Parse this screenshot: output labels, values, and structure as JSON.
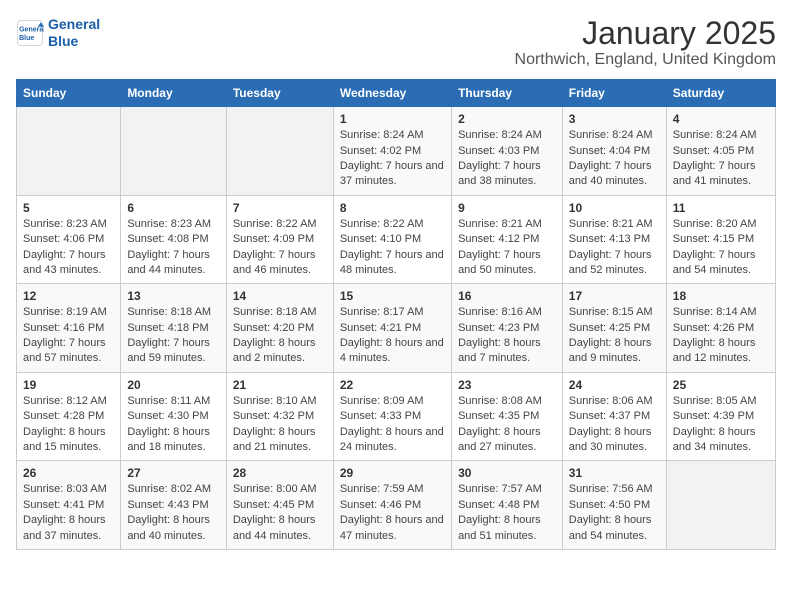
{
  "logo": {
    "line1": "General",
    "line2": "Blue"
  },
  "title": "January 2025",
  "subtitle": "Northwich, England, United Kingdom",
  "weekdays": [
    "Sunday",
    "Monday",
    "Tuesday",
    "Wednesday",
    "Thursday",
    "Friday",
    "Saturday"
  ],
  "weeks": [
    [
      {
        "day": "",
        "info": ""
      },
      {
        "day": "",
        "info": ""
      },
      {
        "day": "",
        "info": ""
      },
      {
        "day": "1",
        "info": "Sunrise: 8:24 AM\nSunset: 4:02 PM\nDaylight: 7 hours and 37 minutes."
      },
      {
        "day": "2",
        "info": "Sunrise: 8:24 AM\nSunset: 4:03 PM\nDaylight: 7 hours and 38 minutes."
      },
      {
        "day": "3",
        "info": "Sunrise: 8:24 AM\nSunset: 4:04 PM\nDaylight: 7 hours and 40 minutes."
      },
      {
        "day": "4",
        "info": "Sunrise: 8:24 AM\nSunset: 4:05 PM\nDaylight: 7 hours and 41 minutes."
      }
    ],
    [
      {
        "day": "5",
        "info": "Sunrise: 8:23 AM\nSunset: 4:06 PM\nDaylight: 7 hours and 43 minutes."
      },
      {
        "day": "6",
        "info": "Sunrise: 8:23 AM\nSunset: 4:08 PM\nDaylight: 7 hours and 44 minutes."
      },
      {
        "day": "7",
        "info": "Sunrise: 8:22 AM\nSunset: 4:09 PM\nDaylight: 7 hours and 46 minutes."
      },
      {
        "day": "8",
        "info": "Sunrise: 8:22 AM\nSunset: 4:10 PM\nDaylight: 7 hours and 48 minutes."
      },
      {
        "day": "9",
        "info": "Sunrise: 8:21 AM\nSunset: 4:12 PM\nDaylight: 7 hours and 50 minutes."
      },
      {
        "day": "10",
        "info": "Sunrise: 8:21 AM\nSunset: 4:13 PM\nDaylight: 7 hours and 52 minutes."
      },
      {
        "day": "11",
        "info": "Sunrise: 8:20 AM\nSunset: 4:15 PM\nDaylight: 7 hours and 54 minutes."
      }
    ],
    [
      {
        "day": "12",
        "info": "Sunrise: 8:19 AM\nSunset: 4:16 PM\nDaylight: 7 hours and 57 minutes."
      },
      {
        "day": "13",
        "info": "Sunrise: 8:18 AM\nSunset: 4:18 PM\nDaylight: 7 hours and 59 minutes."
      },
      {
        "day": "14",
        "info": "Sunrise: 8:18 AM\nSunset: 4:20 PM\nDaylight: 8 hours and 2 minutes."
      },
      {
        "day": "15",
        "info": "Sunrise: 8:17 AM\nSunset: 4:21 PM\nDaylight: 8 hours and 4 minutes."
      },
      {
        "day": "16",
        "info": "Sunrise: 8:16 AM\nSunset: 4:23 PM\nDaylight: 8 hours and 7 minutes."
      },
      {
        "day": "17",
        "info": "Sunrise: 8:15 AM\nSunset: 4:25 PM\nDaylight: 8 hours and 9 minutes."
      },
      {
        "day": "18",
        "info": "Sunrise: 8:14 AM\nSunset: 4:26 PM\nDaylight: 8 hours and 12 minutes."
      }
    ],
    [
      {
        "day": "19",
        "info": "Sunrise: 8:12 AM\nSunset: 4:28 PM\nDaylight: 8 hours and 15 minutes."
      },
      {
        "day": "20",
        "info": "Sunrise: 8:11 AM\nSunset: 4:30 PM\nDaylight: 8 hours and 18 minutes."
      },
      {
        "day": "21",
        "info": "Sunrise: 8:10 AM\nSunset: 4:32 PM\nDaylight: 8 hours and 21 minutes."
      },
      {
        "day": "22",
        "info": "Sunrise: 8:09 AM\nSunset: 4:33 PM\nDaylight: 8 hours and 24 minutes."
      },
      {
        "day": "23",
        "info": "Sunrise: 8:08 AM\nSunset: 4:35 PM\nDaylight: 8 hours and 27 minutes."
      },
      {
        "day": "24",
        "info": "Sunrise: 8:06 AM\nSunset: 4:37 PM\nDaylight: 8 hours and 30 minutes."
      },
      {
        "day": "25",
        "info": "Sunrise: 8:05 AM\nSunset: 4:39 PM\nDaylight: 8 hours and 34 minutes."
      }
    ],
    [
      {
        "day": "26",
        "info": "Sunrise: 8:03 AM\nSunset: 4:41 PM\nDaylight: 8 hours and 37 minutes."
      },
      {
        "day": "27",
        "info": "Sunrise: 8:02 AM\nSunset: 4:43 PM\nDaylight: 8 hours and 40 minutes."
      },
      {
        "day": "28",
        "info": "Sunrise: 8:00 AM\nSunset: 4:45 PM\nDaylight: 8 hours and 44 minutes."
      },
      {
        "day": "29",
        "info": "Sunrise: 7:59 AM\nSunset: 4:46 PM\nDaylight: 8 hours and 47 minutes."
      },
      {
        "day": "30",
        "info": "Sunrise: 7:57 AM\nSunset: 4:48 PM\nDaylight: 8 hours and 51 minutes."
      },
      {
        "day": "31",
        "info": "Sunrise: 7:56 AM\nSunset: 4:50 PM\nDaylight: 8 hours and 54 minutes."
      },
      {
        "day": "",
        "info": ""
      }
    ]
  ]
}
